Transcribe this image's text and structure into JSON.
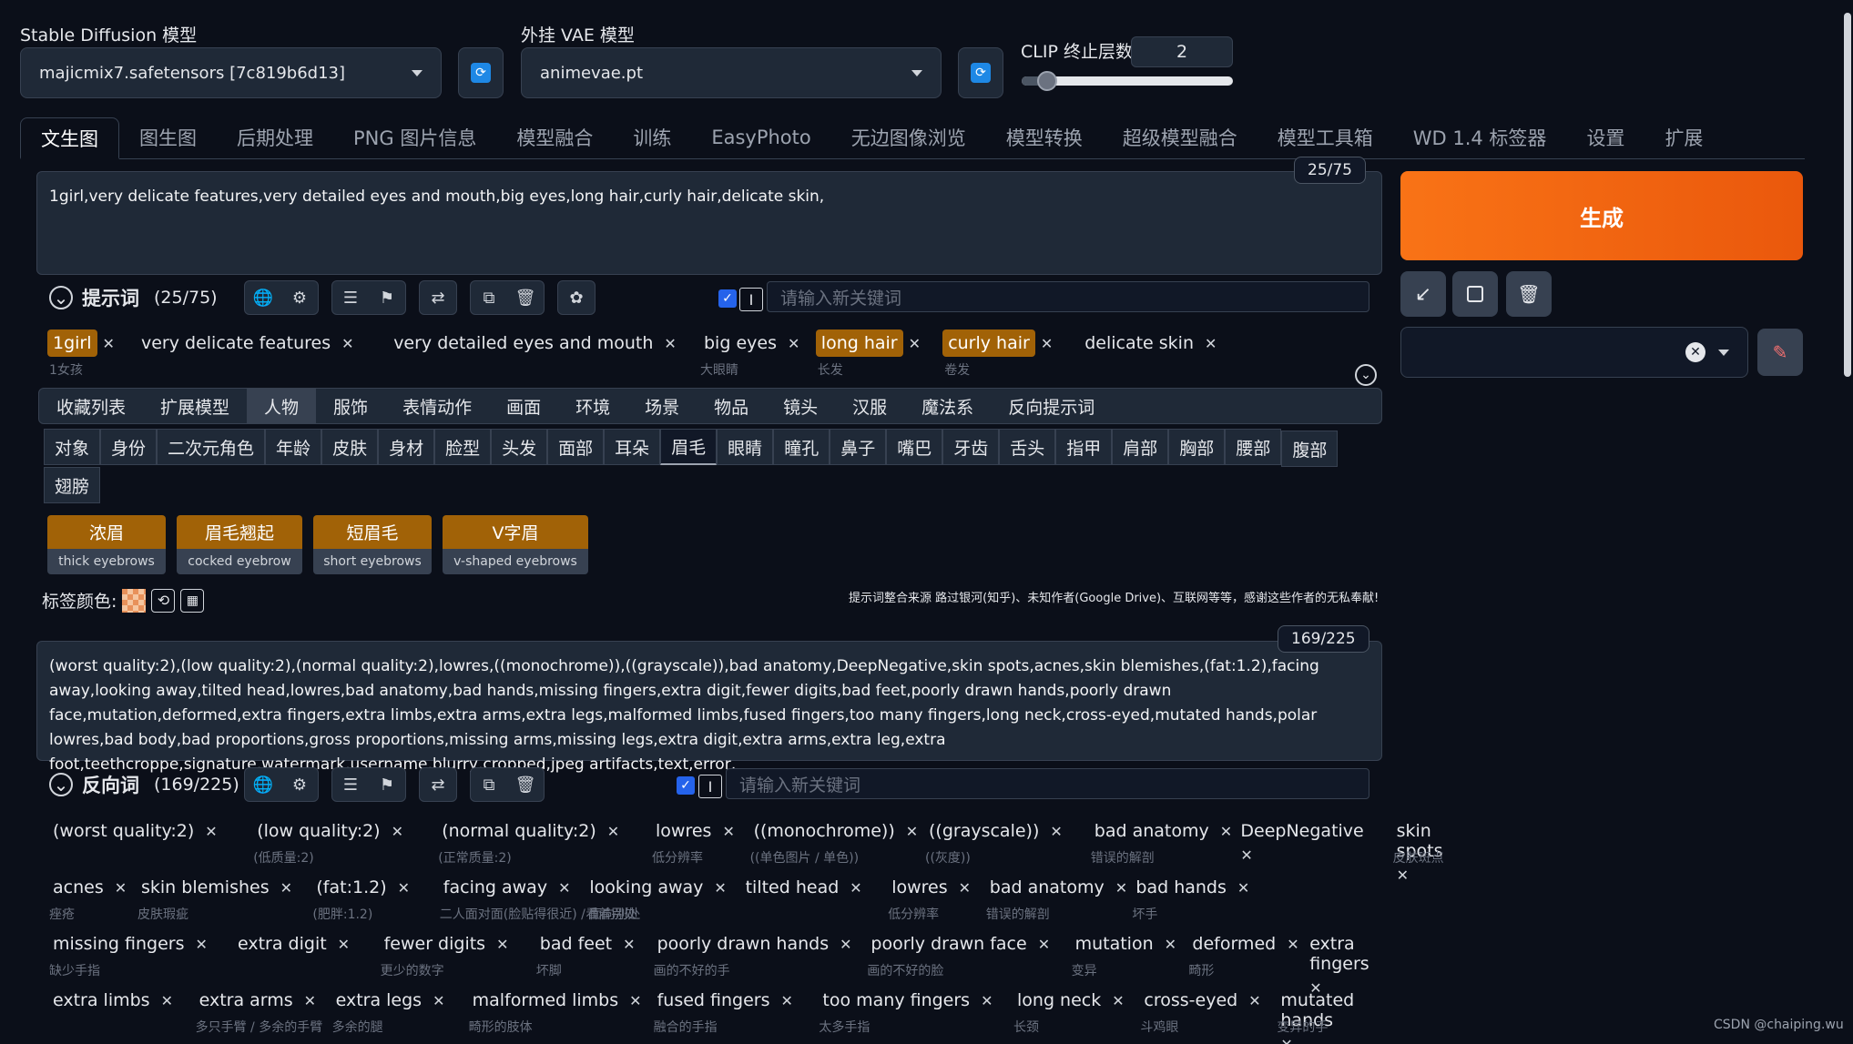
{
  "top": {
    "sd_label": "Stable Diffusion 模型",
    "sd_value": "majicmix7.safetensors [7c819b6d13]",
    "vae_label": "外挂 VAE 模型",
    "vae_value": "animevae.pt",
    "clip_label": "CLIP 终止层数",
    "clip_value": "2",
    "clip_fraction": 0.12
  },
  "tabs": [
    "文生图",
    "图生图",
    "后期处理",
    "PNG 图片信息",
    "模型融合",
    "训练",
    "EasyPhoto",
    "无边图像浏览",
    "模型转换",
    "超级模型融合",
    "模型工具箱",
    "WD 1.4 标签器",
    "设置",
    "扩展"
  ],
  "prompt": {
    "text": "1girl,very delicate features,very detailed eyes and mouth,big eyes,long hair,curly hair,delicate skin,",
    "counter": "25/75",
    "header": "提示词",
    "count": "(25/75)",
    "placeholder": "请输入新关键词",
    "chips": [
      {
        "t": "1girl",
        "hl": true,
        "sub": "1女孩"
      },
      {
        "t": "very delicate features",
        "hl": false,
        "sub": ""
      },
      {
        "t": "very detailed eyes and mouth",
        "hl": false,
        "sub": ""
      },
      {
        "t": "big eyes",
        "hl": false,
        "sub": "大眼睛"
      },
      {
        "t": "long hair",
        "hl": true,
        "sub": "长发"
      },
      {
        "t": "curly hair",
        "hl": true,
        "sub": "卷发"
      },
      {
        "t": "delicate skin",
        "hl": false,
        "sub": ""
      }
    ]
  },
  "categories": [
    "收藏列表",
    "扩展模型",
    "人物",
    "服饰",
    "表情动作",
    "画面",
    "环境",
    "场景",
    "物品",
    "镜头",
    "汉服",
    "魔法系",
    "反向提示词"
  ],
  "subcategories": [
    "对象",
    "身份",
    "二次元角色",
    "年龄",
    "皮肤",
    "身材",
    "脸型",
    "头发",
    "面部",
    "耳朵",
    "眉毛",
    "眼睛",
    "瞳孔",
    "鼻子",
    "嘴巴",
    "牙齿",
    "舌头",
    "指甲",
    "肩部",
    "胸部",
    "腰部",
    "腹部",
    "翅膀"
  ],
  "tags": [
    {
      "cn": "浓眉",
      "en": "thick eyebrows"
    },
    {
      "cn": "眉毛翘起",
      "en": "cocked eyebrow"
    },
    {
      "cn": "短眉毛",
      "en": "short eyebrows"
    },
    {
      "cn": "V字眉",
      "en": "v-shaped eyebrows"
    }
  ],
  "tagcolor_label": "标签颜色:",
  "credit": "提示词整合来源 路过银河(知乎)、未知作者(Google Drive)、互联网等等，感谢这些作者的无私奉献!",
  "negative": {
    "text": "(worst quality:2),(low quality:2),(normal quality:2),lowres,((monochrome)),((grayscale)),bad anatomy,DeepNegative,skin spots,acnes,skin blemishes,(fat:1.2),facing away,looking away,tilted head,lowres,bad anatomy,bad hands,missing fingers,extra digit,fewer digits,bad feet,poorly drawn hands,poorly drawn face,mutation,deformed,extra fingers,extra limbs,extra arms,extra legs,malformed limbs,fused fingers,too many fingers,long neck,cross-eyed,mutated hands,polar lowres,bad body,bad proportions,gross proportions,missing arms,missing legs,extra digit,extra arms,extra leg,extra foot,teethcroppe,signature,watermark,username,blurry,cropped,jpeg artifacts,text,error,",
    "counter": "169/225",
    "header": "反向词",
    "count": "(169/225)",
    "placeholder": "请输入新关键词",
    "rows": [
      [
        {
          "t": "(worst quality:2)",
          "sub": ""
        },
        {
          "t": "(low quality:2)",
          "sub": "(低质量:2)"
        },
        {
          "t": "(normal quality:2)",
          "sub": "(正常质量:2)"
        },
        {
          "t": "lowres",
          "sub": "低分辨率"
        },
        {
          "t": "((monochrome))",
          "sub": "((单色图片 / 单色))"
        },
        {
          "t": "((grayscale))",
          "sub": "((灰度))"
        },
        {
          "t": "bad anatomy",
          "sub": "错误的解剖"
        },
        {
          "t": "DeepNegative",
          "sub": ""
        },
        {
          "t": "skin spots",
          "sub": "皮肤斑点"
        }
      ],
      [
        {
          "t": "acnes",
          "sub": "痤疮"
        },
        {
          "t": "skin blemishes",
          "sub": "皮肤瑕疵"
        },
        {
          "t": "(fat:1.2)",
          "sub": "(肥胖:1.2)"
        },
        {
          "t": "facing away",
          "sub": "二人面对面(脸贴得很近) / 面向别处"
        },
        {
          "t": "looking away",
          "sub": "看着别处"
        },
        {
          "t": "tilted head",
          "sub": ""
        },
        {
          "t": "lowres",
          "sub": "低分辨率"
        },
        {
          "t": "bad anatomy",
          "sub": "错误的解剖"
        },
        {
          "t": "bad hands",
          "sub": "坏手"
        }
      ],
      [
        {
          "t": "missing fingers",
          "sub": "缺少手指"
        },
        {
          "t": "extra digit",
          "sub": ""
        },
        {
          "t": "fewer digits",
          "sub": "更少的数字"
        },
        {
          "t": "bad feet",
          "sub": "坏脚"
        },
        {
          "t": "poorly drawn hands",
          "sub": "画的不好的手"
        },
        {
          "t": "poorly drawn face",
          "sub": "画的不好的脸"
        },
        {
          "t": "mutation",
          "sub": "变异"
        },
        {
          "t": "deformed",
          "sub": "畸形"
        },
        {
          "t": "extra fingers",
          "sub": ""
        }
      ],
      [
        {
          "t": "extra limbs",
          "sub": ""
        },
        {
          "t": "extra arms",
          "sub": "多只手臂 / 多余的手臂"
        },
        {
          "t": "extra legs",
          "sub": "多余的腿"
        },
        {
          "t": "malformed limbs",
          "sub": "畸形的肢体"
        },
        {
          "t": "fused fingers",
          "sub": "融合的手指"
        },
        {
          "t": "too many fingers",
          "sub": "太多手指"
        },
        {
          "t": "long neck",
          "sub": "长颈"
        },
        {
          "t": "cross-eyed",
          "sub": "斗鸡眼"
        },
        {
          "t": "mutated hands",
          "sub": "变异的手"
        }
      ]
    ]
  },
  "generate_label": "生成",
  "watermark": "CSDN @chaiping.wu"
}
